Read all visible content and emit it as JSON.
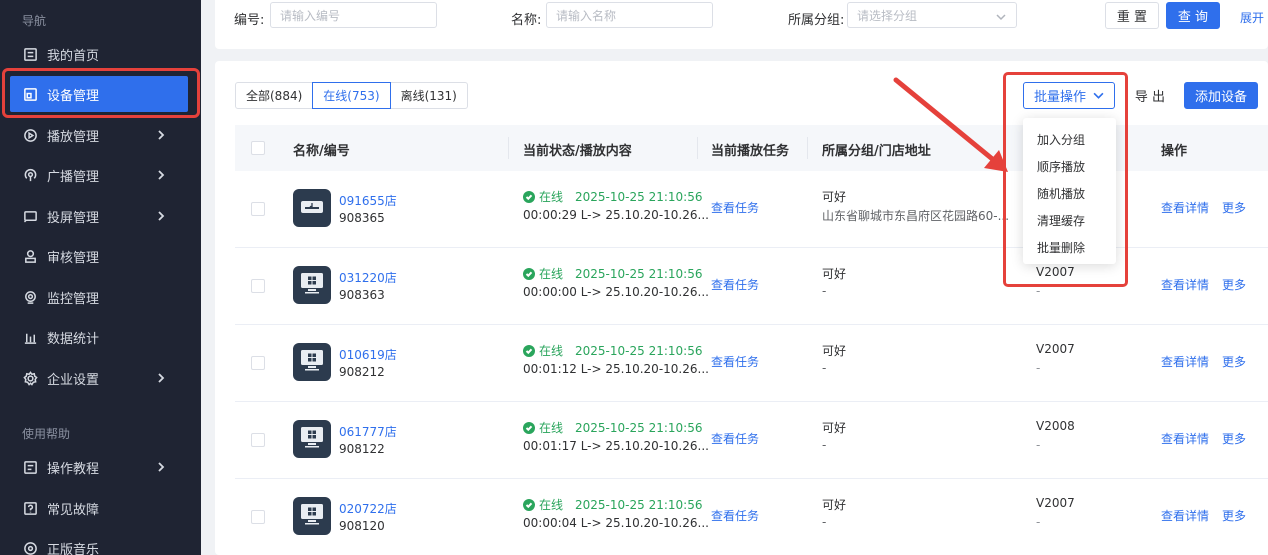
{
  "sidebar": {
    "nav_header": "导航",
    "help_header": "使用帮助",
    "items": [
      {
        "label": "我的首页",
        "icon": "home-icon",
        "arrow": false
      },
      {
        "label": "设备管理",
        "icon": "device-icon",
        "arrow": false,
        "active": true
      },
      {
        "label": "播放管理",
        "icon": "play-icon",
        "arrow": true
      },
      {
        "label": "广播管理",
        "icon": "broadcast-icon",
        "arrow": true
      },
      {
        "label": "投屏管理",
        "icon": "cast-icon",
        "arrow": true
      },
      {
        "label": "审核管理",
        "icon": "audit-icon",
        "arrow": false
      },
      {
        "label": "监控管理",
        "icon": "monitor-icon",
        "arrow": false
      },
      {
        "label": "数据统计",
        "icon": "chart-icon",
        "arrow": false
      },
      {
        "label": "企业设置",
        "icon": "gear-icon",
        "arrow": true
      }
    ],
    "help_items": [
      {
        "label": "操作教程",
        "icon": "tutorial-icon",
        "arrow": true
      },
      {
        "label": "常见故障",
        "icon": "question-icon",
        "arrow": false
      },
      {
        "label": "正版音乐",
        "icon": "music-icon",
        "arrow": false
      }
    ]
  },
  "filters": {
    "code_label": "编号:",
    "code_placeholder": "请输入编号",
    "name_label": "名称:",
    "name_placeholder": "请输入名称",
    "group_label": "所属分组:",
    "group_placeholder": "请选择分组",
    "reset_label": "重 置",
    "query_label": "查 询",
    "expand_label": "展开"
  },
  "tabs": [
    {
      "label": "全部(884)"
    },
    {
      "label": "在线(753)",
      "active": true
    },
    {
      "label": "离线(131)"
    }
  ],
  "toolbar": {
    "batch_label": "批量操作",
    "export_label": "导 出",
    "add_label": "添加设备"
  },
  "table": {
    "headers": {
      "name": "名称/编号",
      "status": "当前状态/播放内容",
      "task": "当前播放任务",
      "group": "所属分组/门店地址",
      "action": "操作"
    },
    "rows": [
      {
        "name": "091655店",
        "code": "908365",
        "status": "在线",
        "time": "2025-10-25 21:10:56",
        "play": "00:00:29 L-> 25.10.20-10.26...",
        "task": "查看任务",
        "group": "可好",
        "addr": "山东省聊城市东昌府区花园路60-...",
        "ver": "",
        "ver2": "",
        "detail": "查看详情",
        "more": "更多",
        "thumb": "music"
      },
      {
        "name": "031220店",
        "code": "908363",
        "status": "在线",
        "time": "2025-10-25 21:10:56",
        "play": "00:00:00 L-> 25.10.20-10.26...",
        "task": "查看任务",
        "group": "可好",
        "addr": "-",
        "ver": "V2007",
        "ver2": "-",
        "detail": "查看详情",
        "more": "更多",
        "thumb": "windows"
      },
      {
        "name": "010619店",
        "code": "908212",
        "status": "在线",
        "time": "2025-10-25 21:10:56",
        "play": "00:01:12 L-> 25.10.20-10.26...",
        "task": "查看任务",
        "group": "可好",
        "addr": "-",
        "ver": "V2007",
        "ver2": "-",
        "detail": "查看详情",
        "more": "更多",
        "thumb": "windows"
      },
      {
        "name": "061777店",
        "code": "908122",
        "status": "在线",
        "time": "2025-10-25 21:10:56",
        "play": "00:01:17 L-> 25.10.20-10.26...",
        "task": "查看任务",
        "group": "可好",
        "addr": "-",
        "ver": "V2008",
        "ver2": "-",
        "detail": "查看详情",
        "more": "更多",
        "thumb": "windows"
      },
      {
        "name": "020722店",
        "code": "908120",
        "status": "在线",
        "time": "2025-10-25 21:10:56",
        "play": "00:00:04 L-> 25.10.20-10.26...",
        "task": "查看任务",
        "group": "可好",
        "addr": "-",
        "ver": "V2007",
        "ver2": "-",
        "detail": "查看详情",
        "more": "更多",
        "thumb": "windows"
      }
    ]
  },
  "dropdown": {
    "items": [
      "加入分组",
      "顺序播放",
      "随机播放",
      "清理缓存",
      "批量删除"
    ]
  },
  "colors": {
    "primary": "#2f6fec",
    "sidebar_bg": "#1f2433",
    "online_green": "#2aa55c",
    "annotation_red": "#e5413b"
  }
}
